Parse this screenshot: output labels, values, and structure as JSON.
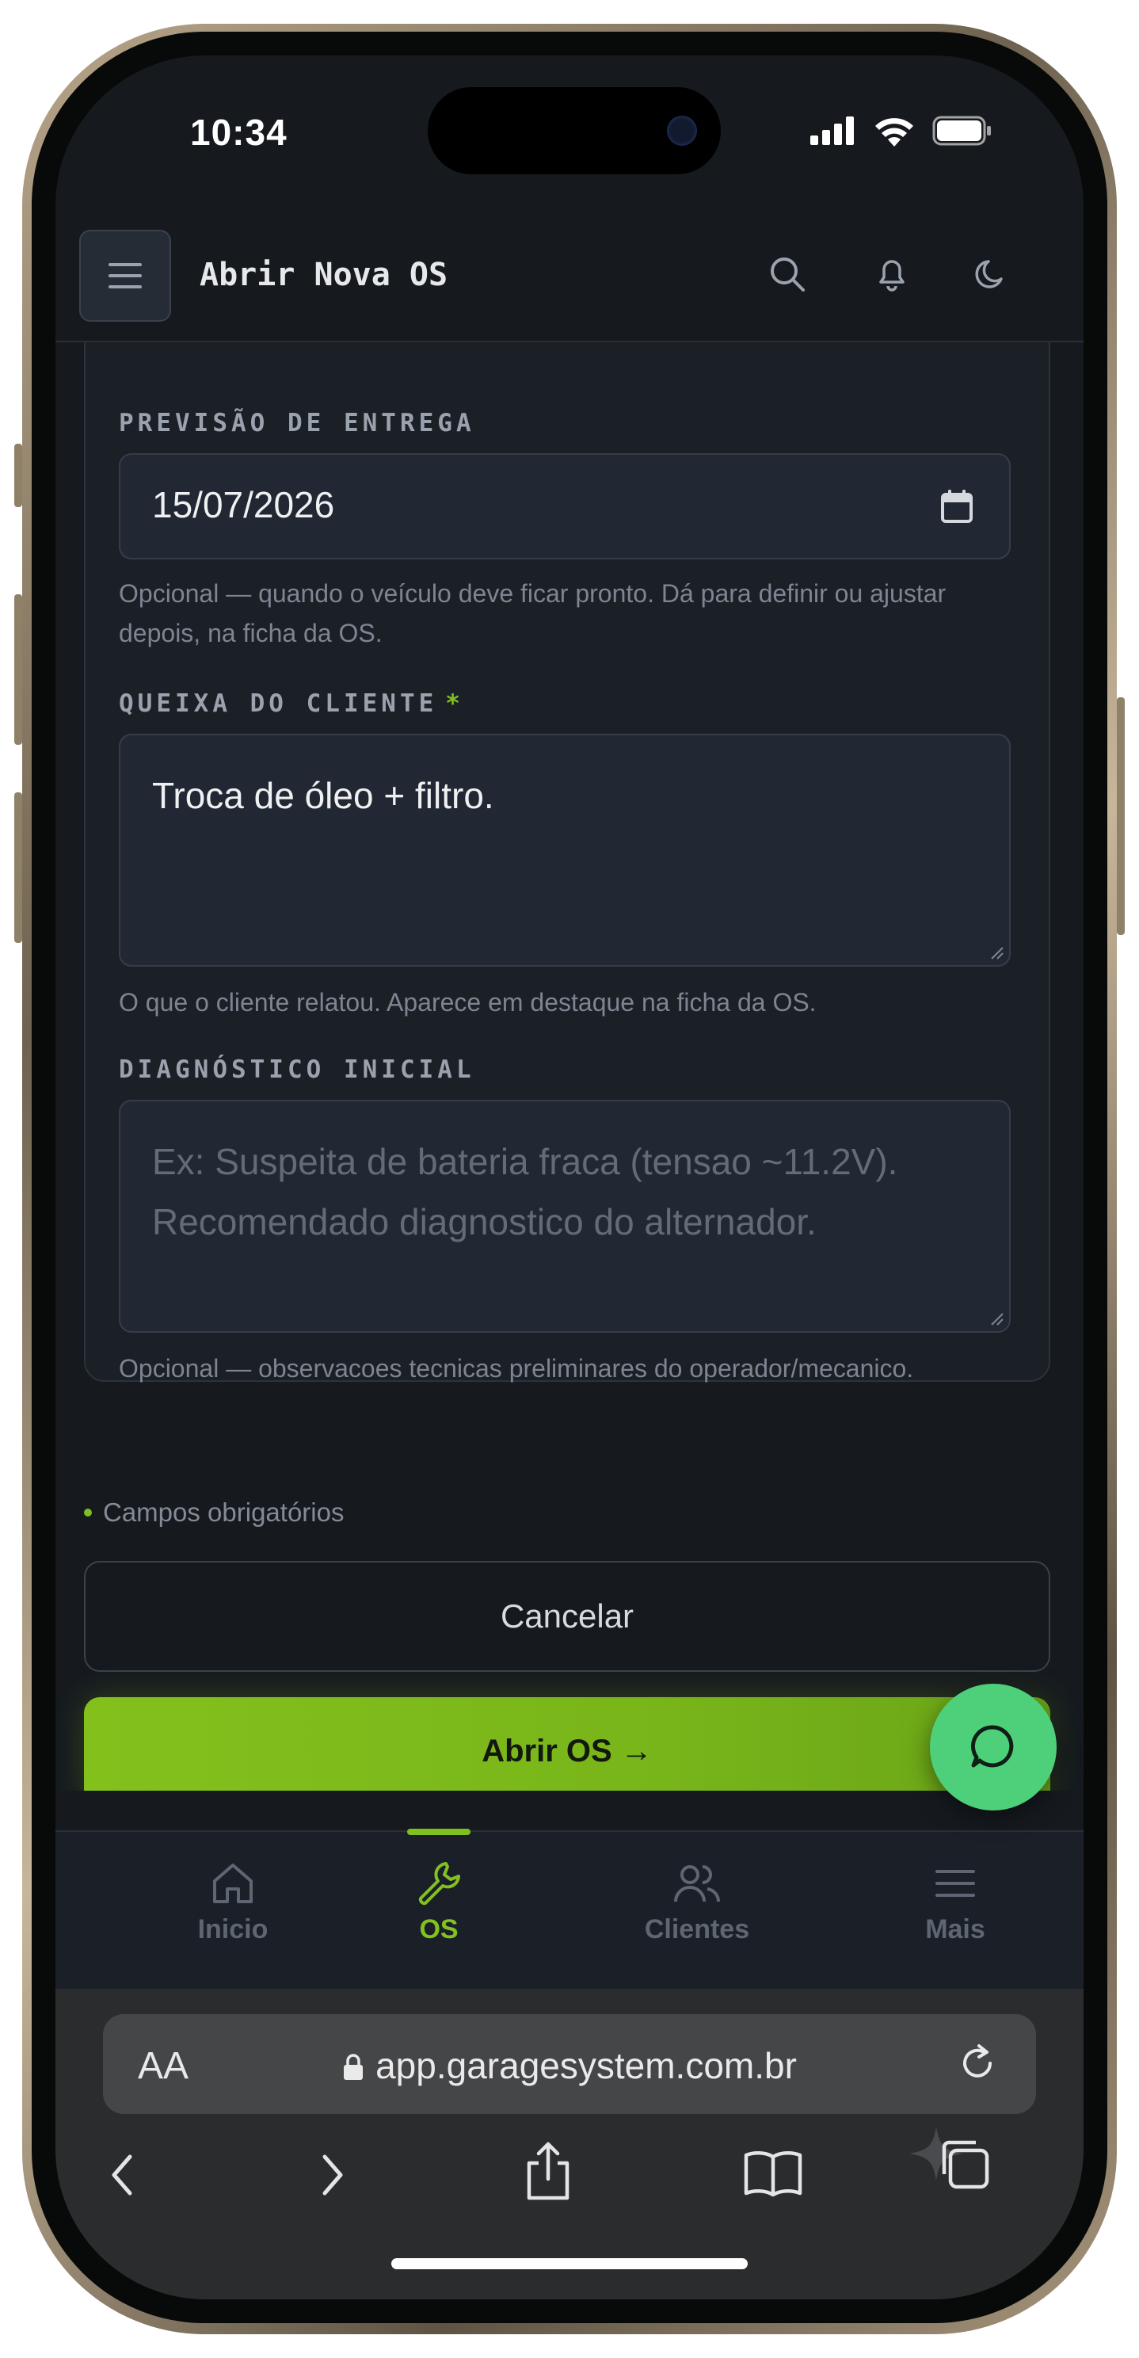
{
  "status_bar": {
    "time": "10:34"
  },
  "header": {
    "title": "Abrir Nova OS"
  },
  "form": {
    "delivery": {
      "label": "PREVISÃO DE ENTREGA",
      "value": "15/07/2026",
      "help": "Opcional — quando o veículo deve ficar pronto. Dá para definir ou ajustar depois, na ficha da OS."
    },
    "complaint": {
      "label": "QUEIXA DO CLIENTE",
      "required_mark": "*",
      "value": "Troca de óleo + filtro.",
      "help": "O que o cliente relatou. Aparece em destaque na ficha da OS."
    },
    "diagnosis": {
      "label": "DIAGNÓSTICO INICIAL",
      "placeholder": "Ex: Suspeita de bateria fraca (tensao ~11.2V). Recomendado diagnostico do alternador.",
      "help": "Opcional — observacoes tecnicas preliminares do operador/mecanico."
    }
  },
  "required_note": "Campos obrigatórios",
  "buttons": {
    "cancel": "Cancelar",
    "submit": "Abrir OS →"
  },
  "bottom_nav": {
    "items": [
      {
        "label": "Inicio",
        "icon": "home-icon",
        "active": false
      },
      {
        "label": "OS",
        "icon": "wrench-icon",
        "active": true
      },
      {
        "label": "Clientes",
        "icon": "users-icon",
        "active": false
      },
      {
        "label": "Mais",
        "icon": "menu-icon",
        "active": false
      }
    ]
  },
  "browser": {
    "text_size": "AA",
    "url": "app.garagesystem.com.br"
  },
  "colors": {
    "accent": "#7fbf1e",
    "background": "#161a1f",
    "chat_fab": "#4ed07a"
  }
}
